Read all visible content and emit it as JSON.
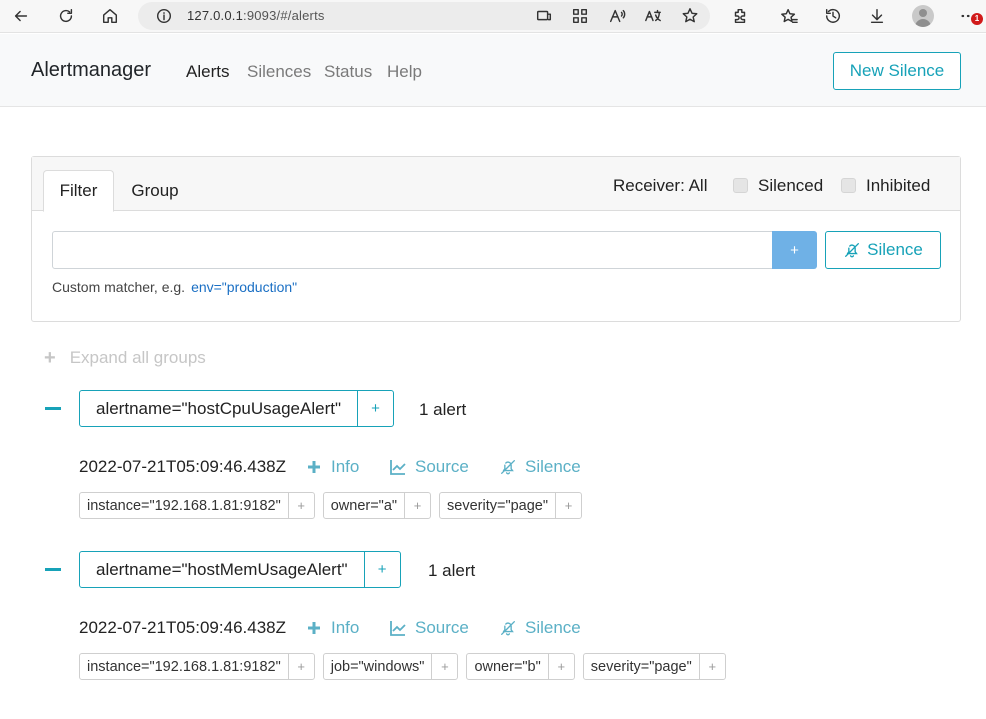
{
  "browser": {
    "url_host": "127.0.0.1",
    "url_rest": ":9093/#/alerts",
    "notification_count": "1"
  },
  "navbar": {
    "brand": "Alertmanager",
    "links": [
      "Alerts",
      "Silences",
      "Status",
      "Help"
    ],
    "new_silence_label": "New Silence"
  },
  "filter": {
    "tabs": [
      "Filter",
      "Group"
    ],
    "receiver": "Receiver: All",
    "silenced_label": "Silenced",
    "inhibited_label": "Inhibited",
    "input_value": "",
    "add_label": "+",
    "silence_label": "Silence",
    "hint_text": "Custom matcher, e.g.",
    "hint_example": "env=\"production\""
  },
  "expand_all_label": "Expand all groups",
  "groups": [
    {
      "label": "alertname=\"hostCpuUsageAlert\"",
      "count": "1 alert",
      "alerts": [
        {
          "time": "2022-07-21T05:09:46.438Z",
          "actions": [
            "Info",
            "Source",
            "Silence"
          ],
          "labels": [
            "instance=\"192.168.1.81:9182\"",
            "owner=\"a\"",
            "severity=\"page\""
          ]
        }
      ]
    },
    {
      "label": "alertname=\"hostMemUsageAlert\"",
      "count": "1 alert",
      "alerts": [
        {
          "time": "2022-07-21T05:09:46.438Z",
          "actions": [
            "Info",
            "Source",
            "Silence"
          ],
          "labels": [
            "instance=\"192.168.1.81:9182\"",
            "job=\"windows\"",
            "owner=\"b\"",
            "severity=\"page\""
          ]
        }
      ]
    }
  ],
  "label_add": "+",
  "colors": {
    "accent": "#17a2b8",
    "primary_button": "#6fb1e6",
    "link": "#1a6fc4"
  }
}
